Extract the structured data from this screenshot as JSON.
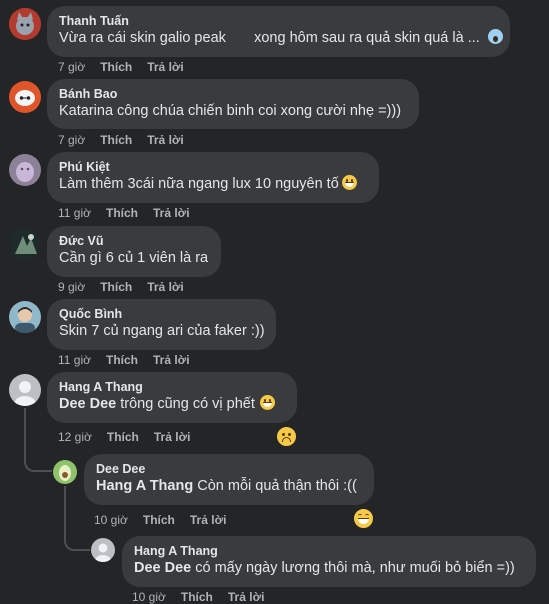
{
  "comments": [
    {
      "author": "Thanh Tuấn",
      "text": "Vừa ra cái skin galio peak",
      "text_tail": "xong hôm sau ra quả skin quá là ...",
      "time": "7 giờ",
      "like": "Thích",
      "reply": "Trả lời"
    },
    {
      "author": "Bánh Bao",
      "text": "Katarina công chúa chiến binh coi xong cười nhẹ =)))",
      "time": "7 giờ",
      "like": "Thích",
      "reply": "Trả lời"
    },
    {
      "author": "Phú Kiệt",
      "text": "Làm thêm 3cái nữa ngang lux 10 nguyên tố",
      "time": "11 giờ",
      "like": "Thích",
      "reply": "Trả lời"
    },
    {
      "author": "Đức Vũ",
      "text": "Cần gì 6 củ 1 viên là ra",
      "time": "9 giờ",
      "like": "Thích",
      "reply": "Trả lời"
    },
    {
      "author": "Quốc Bình",
      "text": "Skin 7 củ ngang ari của faker :))",
      "time": "11 giờ",
      "like": "Thích",
      "reply": "Trả lời"
    },
    {
      "author": "Hang A Thang",
      "mention": "Dee Dee",
      "text": "trông cũng có vị phết",
      "time": "12 giờ",
      "like": "Thích",
      "reply": "Trả lời"
    },
    {
      "author": "Dee Dee",
      "mention": "Hang A Thang",
      "text": "Còn mỗi quả thận thôi :((",
      "time": "10 giờ",
      "like": "Thích",
      "reply": "Trả lời"
    },
    {
      "author": "Hang A Thang",
      "mention": "Dee Dee",
      "text": "có mấy ngày lương thôi mà, như muối bỏ biển =))",
      "time": "10 giờ",
      "like": "Thích",
      "reply": "Trả lời"
    }
  ],
  "colors": {
    "background": "#242526",
    "bubble": "#3a3b3c",
    "text": "#e4e6eb",
    "muted": "#b0b3b8"
  }
}
